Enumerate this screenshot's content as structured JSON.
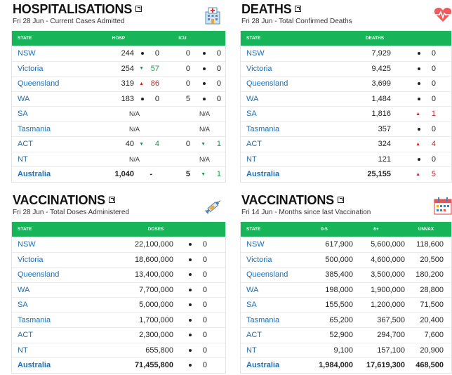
{
  "hospitalisations": {
    "title": "HOSPITALISATIONS",
    "subtitle": "Fri 28 Jun - Current Cases Admitted",
    "icon": "hospital-icon",
    "headers": {
      "state": "STATE",
      "hosp": "HOSP",
      "icu": "ICU"
    },
    "rows": [
      {
        "state": "NSW",
        "hosp": "244",
        "hosp_ch": "0",
        "hosp_dir": "none",
        "icu": "0",
        "icu_ch": "0",
        "icu_dir": "none"
      },
      {
        "state": "Victoria",
        "hosp": "254",
        "hosp_ch": "57",
        "hosp_dir": "down",
        "icu": "0",
        "icu_ch": "0",
        "icu_dir": "none"
      },
      {
        "state": "Queensland",
        "hosp": "319",
        "hosp_ch": "86",
        "hosp_dir": "up",
        "icu": "0",
        "icu_ch": "0",
        "icu_dir": "none"
      },
      {
        "state": "WA",
        "hosp": "183",
        "hosp_ch": "0",
        "hosp_dir": "none",
        "icu": "5",
        "icu_ch": "0",
        "icu_dir": "none"
      },
      {
        "state": "SA",
        "hosp": "N/A",
        "hosp_ch": "",
        "hosp_dir": "na",
        "icu": "N/A",
        "icu_ch": "",
        "icu_dir": "na"
      },
      {
        "state": "Tasmania",
        "hosp": "N/A",
        "hosp_ch": "",
        "hosp_dir": "na",
        "icu": "N/A",
        "icu_ch": "",
        "icu_dir": "na"
      },
      {
        "state": "ACT",
        "hosp": "40",
        "hosp_ch": "4",
        "hosp_dir": "down",
        "icu": "0",
        "icu_ch": "1",
        "icu_dir": "down"
      },
      {
        "state": "NT",
        "hosp": "N/A",
        "hosp_ch": "",
        "hosp_dir": "na",
        "icu": "N/A",
        "icu_ch": "",
        "icu_dir": "na"
      },
      {
        "state": "Australia",
        "hosp": "1,040",
        "hosp_ch": "-",
        "hosp_dir": "dash",
        "icu": "5",
        "icu_ch": "1",
        "icu_dir": "down",
        "total": true
      }
    ]
  },
  "deaths": {
    "title": "DEATHS",
    "subtitle": "Fri 28 Jun - Total Confirmed Deaths",
    "icon": "heart-pulse-icon",
    "headers": {
      "state": "STATE",
      "deaths": "DEATHS"
    },
    "rows": [
      {
        "state": "NSW",
        "value": "7,929",
        "ch": "0",
        "dir": "none"
      },
      {
        "state": "Victoria",
        "value": "9,425",
        "ch": "0",
        "dir": "none"
      },
      {
        "state": "Queensland",
        "value": "3,699",
        "ch": "0",
        "dir": "none"
      },
      {
        "state": "WA",
        "value": "1,484",
        "ch": "0",
        "dir": "none"
      },
      {
        "state": "SA",
        "value": "1,816",
        "ch": "1",
        "dir": "up"
      },
      {
        "state": "Tasmania",
        "value": "357",
        "ch": "0",
        "dir": "none"
      },
      {
        "state": "ACT",
        "value": "324",
        "ch": "4",
        "dir": "up"
      },
      {
        "state": "NT",
        "value": "121",
        "ch": "0",
        "dir": "none"
      },
      {
        "state": "Australia",
        "value": "25,155",
        "ch": "5",
        "dir": "up",
        "total": true
      }
    ]
  },
  "vaccinations": {
    "title": "VACCINATIONS",
    "subtitle": "Fri 28 Jun - Total Doses Administered",
    "icon": "syringe-icon",
    "headers": {
      "state": "STATE",
      "doses": "DOSES"
    },
    "rows": [
      {
        "state": "NSW",
        "value": "22,100,000",
        "ch": "0",
        "dir": "none"
      },
      {
        "state": "Victoria",
        "value": "18,600,000",
        "ch": "0",
        "dir": "none"
      },
      {
        "state": "Queensland",
        "value": "13,400,000",
        "ch": "0",
        "dir": "none"
      },
      {
        "state": "WA",
        "value": "7,700,000",
        "ch": "0",
        "dir": "none"
      },
      {
        "state": "SA",
        "value": "5,000,000",
        "ch": "0",
        "dir": "none"
      },
      {
        "state": "Tasmania",
        "value": "1,700,000",
        "ch": "0",
        "dir": "none"
      },
      {
        "state": "ACT",
        "value": "2,300,000",
        "ch": "0",
        "dir": "none"
      },
      {
        "state": "NT",
        "value": "655,800",
        "ch": "0",
        "dir": "none"
      },
      {
        "state": "Australia",
        "value": "71,455,800",
        "ch": "0",
        "dir": "none",
        "total": true
      }
    ]
  },
  "vaccinations_months": {
    "title": "VACCINATIONS",
    "subtitle": "Fri 14 Jun - Months since last Vaccination",
    "icon": "calendar-icon",
    "headers": {
      "state": "STATE",
      "c1": "0-5",
      "c2": "6+",
      "c3": "UNVAX"
    },
    "rows": [
      {
        "state": "NSW",
        "c1": "617,900",
        "c2": "5,600,000",
        "c3": "118,600"
      },
      {
        "state": "Victoria",
        "c1": "500,000",
        "c2": "4,600,000",
        "c3": "20,500"
      },
      {
        "state": "Queensland",
        "c1": "385,400",
        "c2": "3,500,000",
        "c3": "180,200"
      },
      {
        "state": "WA",
        "c1": "198,000",
        "c2": "1,900,000",
        "c3": "28,800"
      },
      {
        "state": "SA",
        "c1": "155,500",
        "c2": "1,200,000",
        "c3": "71,500"
      },
      {
        "state": "Tasmania",
        "c1": "65,200",
        "c2": "367,500",
        "c3": "20,400"
      },
      {
        "state": "ACT",
        "c1": "52,900",
        "c2": "294,700",
        "c3": "7,600"
      },
      {
        "state": "NT",
        "c1": "9,100",
        "c2": "157,100",
        "c3": "20,900"
      },
      {
        "state": "Australia",
        "c1": "1,984,000",
        "c2": "17,619,300",
        "c3": "468,500",
        "total": true
      }
    ]
  },
  "colors": {
    "header_green": "#17b45a",
    "state_blue": "#1f6fb5",
    "up_red": "#d22222",
    "down_green": "#1a9a4a"
  }
}
